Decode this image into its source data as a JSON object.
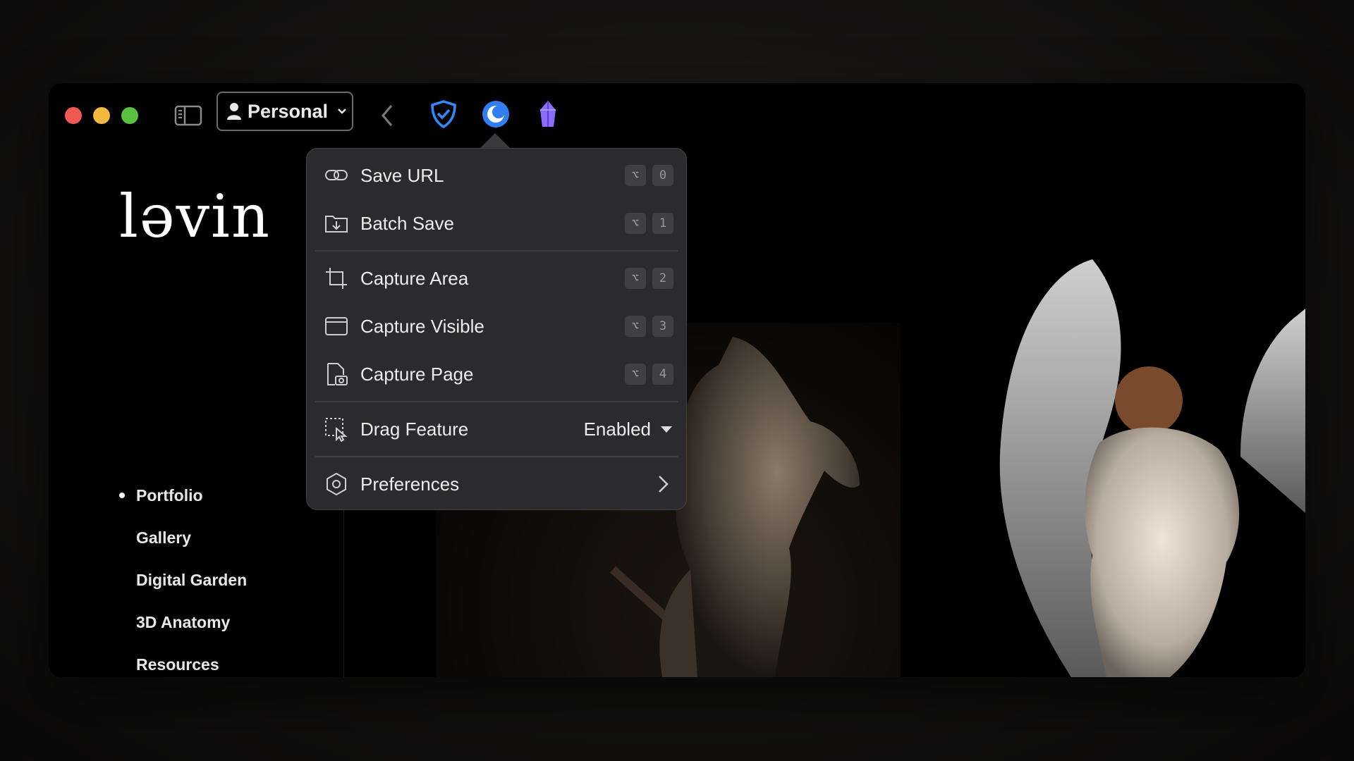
{
  "toolbar": {
    "profile_label": "Personal"
  },
  "site": {
    "logo": "ləvin",
    "nav": [
      {
        "label": "Portfolio",
        "active": true
      },
      {
        "label": "Gallery"
      },
      {
        "label": "Digital Garden"
      },
      {
        "label": "3D Anatomy"
      },
      {
        "label": "Resources"
      }
    ]
  },
  "menu": {
    "items": [
      {
        "label": "Save URL",
        "icon": "link-icon",
        "keys": [
          "⌥",
          "0"
        ]
      },
      {
        "label": "Batch Save",
        "icon": "folder-download-icon",
        "keys": [
          "⌥",
          "1"
        ]
      },
      {
        "label": "Capture Area",
        "icon": "crop-icon",
        "keys": [
          "⌥",
          "2"
        ]
      },
      {
        "label": "Capture Visible",
        "icon": "browser-window-icon",
        "keys": [
          "⌥",
          "3"
        ]
      },
      {
        "label": "Capture Page",
        "icon": "page-camera-icon",
        "keys": [
          "⌥",
          "4"
        ]
      }
    ],
    "drag": {
      "label": "Drag Feature",
      "value": "Enabled"
    },
    "preferences": {
      "label": "Preferences"
    }
  },
  "colors": {
    "traffic_red": "#ee5a52",
    "traffic_yellow": "#f5b83b",
    "traffic_green": "#58c13f",
    "shield_blue": "#2f8cff",
    "crystal_purple": "#8b6cff"
  }
}
